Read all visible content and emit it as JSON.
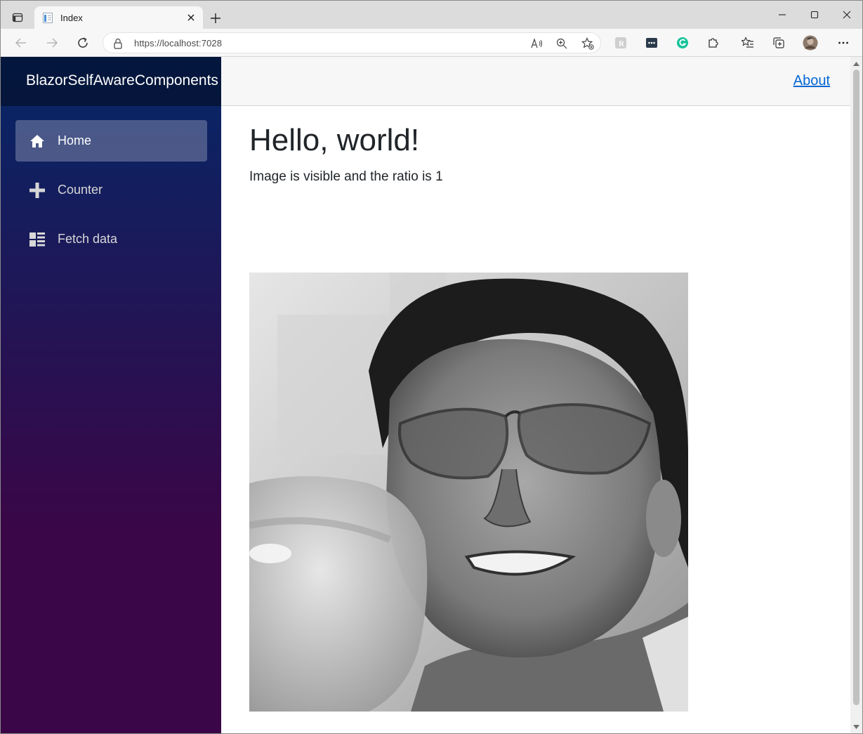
{
  "browser": {
    "tab": {
      "title": "Index"
    },
    "address_bar": {
      "url": "https://localhost:7028"
    }
  },
  "app": {
    "brand": "BlazorSelfAwareComponents",
    "nav": [
      {
        "label": "Home",
        "icon": "home-icon",
        "active": true
      },
      {
        "label": "Counter",
        "icon": "plus-icon",
        "active": false
      },
      {
        "label": "Fetch data",
        "icon": "list-rich-icon",
        "active": false
      }
    ],
    "topbar": {
      "about_label": "About"
    },
    "content": {
      "heading": "Hello, world!",
      "status": "Image is visible and the ratio is 1"
    }
  },
  "colors": {
    "sidebar_top": "#052767",
    "sidebar_bottom": "#3a0647",
    "link": "#0366d6",
    "text": "#212529"
  }
}
